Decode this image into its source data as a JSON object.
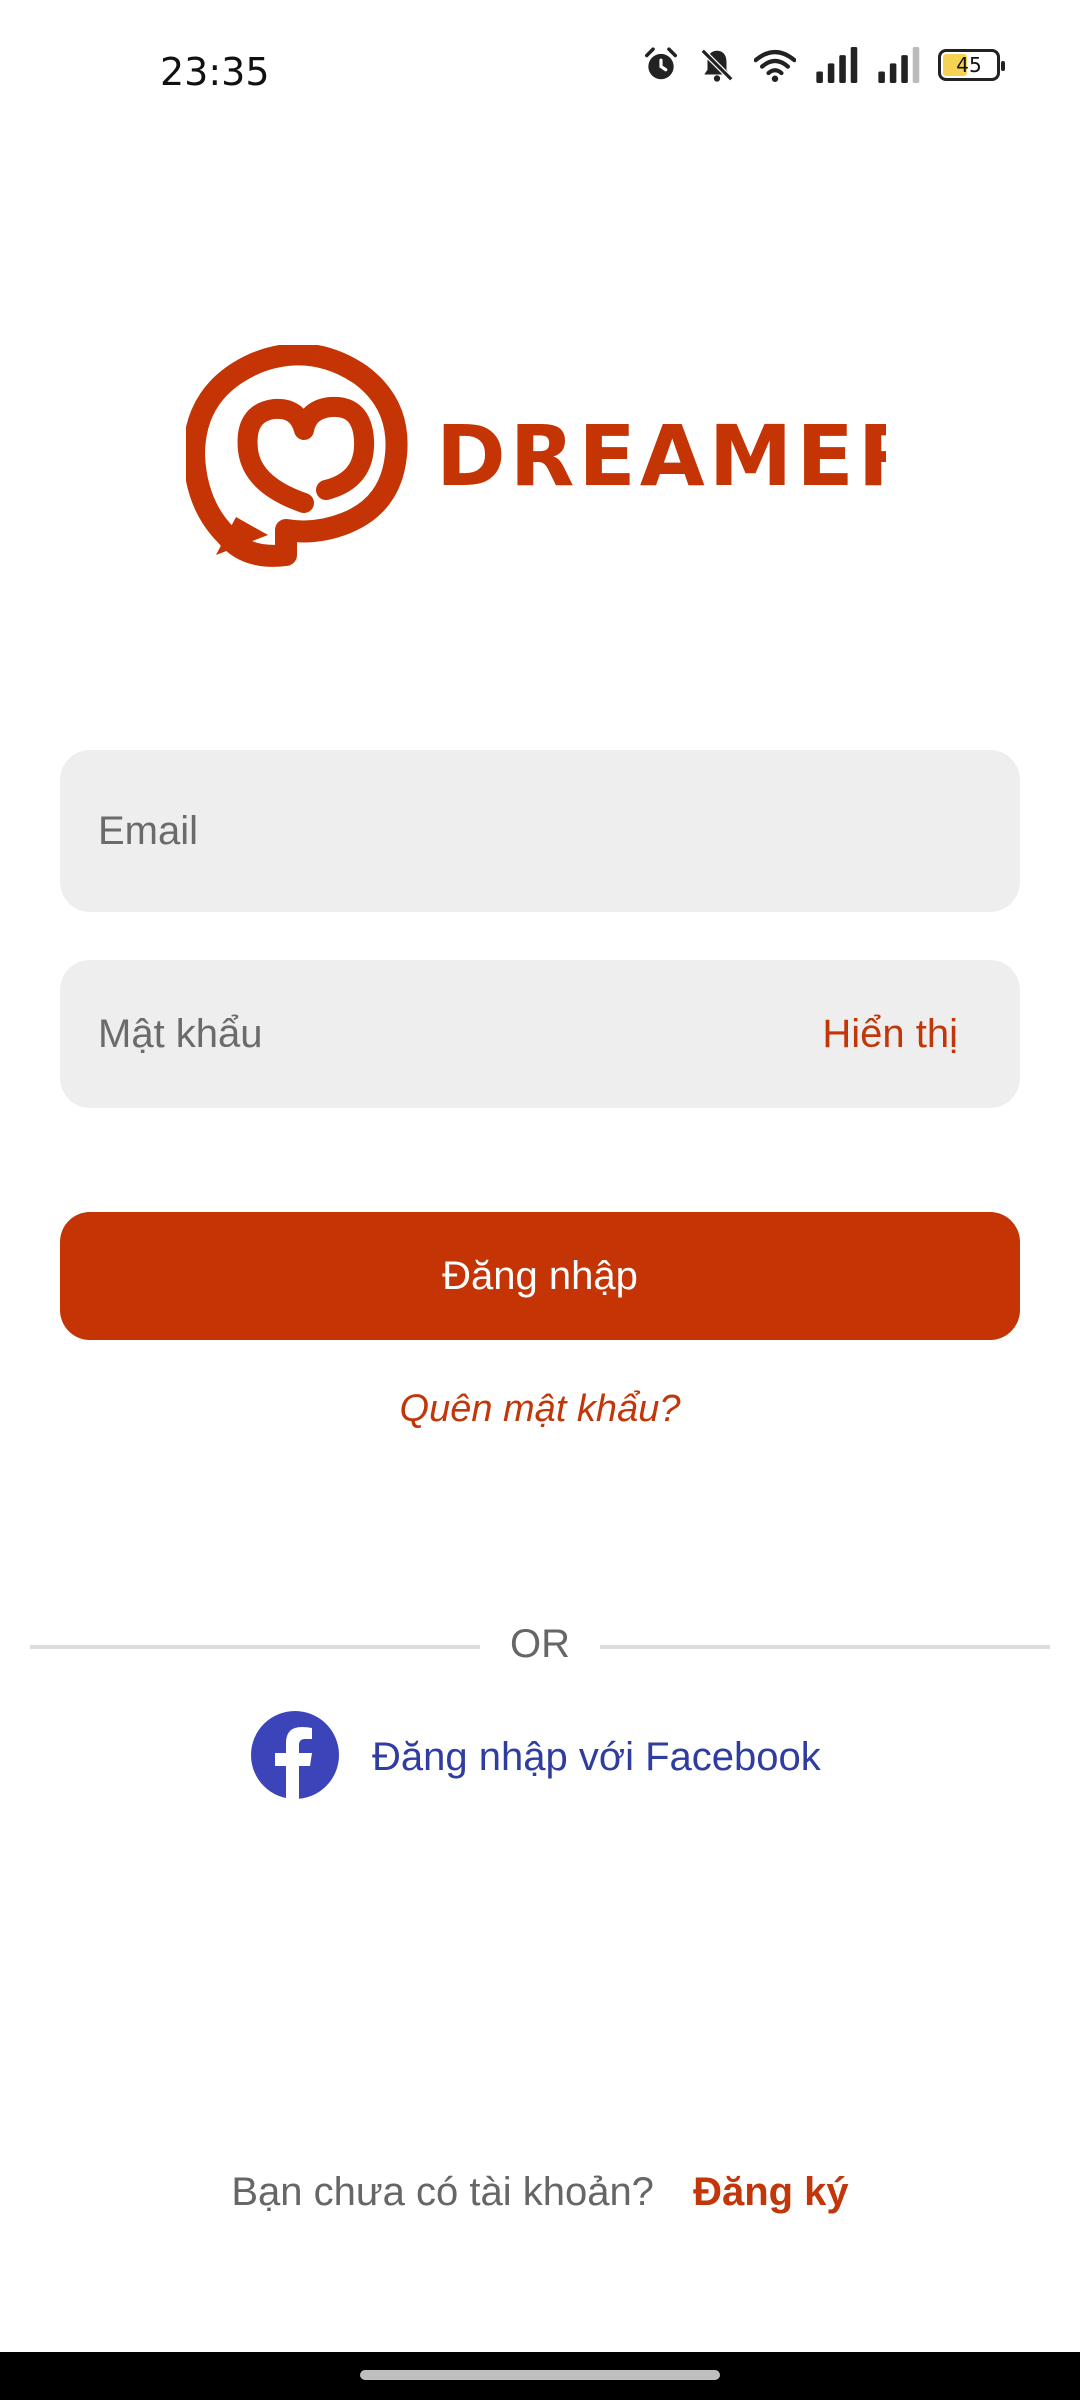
{
  "status_bar": {
    "time": "23:35",
    "battery_level": "45",
    "icons": [
      "alarm-icon",
      "bell-off-icon",
      "wifi-icon",
      "signal-icon",
      "signal-icon",
      "battery-icon"
    ]
  },
  "logo": {
    "brand_name": "DREAMERS",
    "color": "#c43404"
  },
  "form": {
    "email_placeholder": "Email",
    "password_placeholder": "Mật khẩu",
    "show_password_label": "Hiển thị",
    "login_button_label": "Đăng nhập",
    "forgot_password_label": "Quên mật khẩu?"
  },
  "divider": {
    "label": "OR"
  },
  "facebook": {
    "label": "Đăng nhập với Facebook",
    "color": "#3b44b9"
  },
  "signup": {
    "prompt": "Bạn chưa có tài khoản?",
    "link_label": "Đăng ký"
  },
  "colors": {
    "accent": "#c43404",
    "input_bg": "#eeeeee",
    "facebook_text": "#2f3da0"
  }
}
